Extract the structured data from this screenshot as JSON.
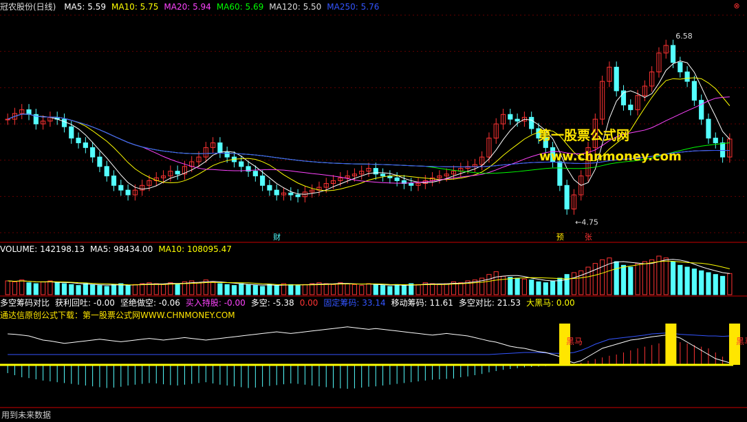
{
  "header": {
    "stock": "冠农股份(日线)",
    "ma": [
      {
        "label": "MA5: 5.59",
        "color": "#ffffff"
      },
      {
        "label": "MA10: 5.75",
        "color": "#ffff00"
      },
      {
        "label": "MA20: 5.94",
        "color": "#ff44ff"
      },
      {
        "label": "MA60: 5.69",
        "color": "#00ff00"
      },
      {
        "label": "MA120: 5.50",
        "color": "#dddddd"
      },
      {
        "label": "MA250: 5.76",
        "color": "#3355ff"
      }
    ]
  },
  "volume_header": [
    {
      "label": "VOLUME: 142198.13",
      "color": "#ffffff"
    },
    {
      "label": "MA5: 98434.00",
      "color": "#ffffff"
    },
    {
      "label": "MA10: 108095.47",
      "color": "#ffff00"
    }
  ],
  "indicator_header": [
    {
      "label": "多空筹码对比",
      "color": "#ffffff"
    },
    {
      "label": "获利回吐: -0.00",
      "color": "#ffffff"
    },
    {
      "label": "坚绝做空: -0.06",
      "color": "#ffffff"
    },
    {
      "label": "买入持股: -0.00",
      "color": "#ff44ff"
    },
    {
      "label": "多空: -5.38",
      "color": "#ffffff"
    },
    {
      "label": "0.00",
      "color": "#ff3333"
    },
    {
      "label": "固定筹码: 33.14",
      "color": "#3355ff"
    },
    {
      "label": "移动筹码: 11.61",
      "color": "#ffffff"
    },
    {
      "label": "多空对比: 21.53",
      "color": "#ffffff"
    },
    {
      "label": "大黑马: 0.00",
      "color": "#ffff00"
    }
  ],
  "indicator_note": "通达信原创公式下载：第一股票公式网WWW.CHNMONEY.COM",
  "watermark": {
    "title": "第一股票公式网",
    "url": "www.chnmoney.com"
  },
  "footer": "用到未来数据",
  "markers": {
    "cai": "财",
    "yu": "预",
    "zhang": "张",
    "heima": "黑马"
  },
  "chart_data": {
    "type": "candlestick",
    "high_label": "6.58",
    "low_label": "4.75",
    "ylim": [
      4.6,
      6.9
    ],
    "closes": [
      5.8,
      5.86,
      5.9,
      5.85,
      5.75,
      5.78,
      5.82,
      5.8,
      5.72,
      5.6,
      5.55,
      5.5,
      5.4,
      5.3,
      5.2,
      5.1,
      5.05,
      5.0,
      5.05,
      5.1,
      5.15,
      5.18,
      5.2,
      5.25,
      5.22,
      5.3,
      5.35,
      5.4,
      5.5,
      5.55,
      5.45,
      5.4,
      5.35,
      5.3,
      5.25,
      5.2,
      5.1,
      5.05,
      5.0,
      5.02,
      5.0,
      4.98,
      5.03,
      5.05,
      5.08,
      5.12,
      5.15,
      5.18,
      5.2,
      5.22,
      5.25,
      5.28,
      5.22,
      5.2,
      5.18,
      5.15,
      5.12,
      5.1,
      5.12,
      5.15,
      5.18,
      5.2,
      5.22,
      5.25,
      5.28,
      5.3,
      5.32,
      5.4,
      5.6,
      5.75,
      5.85,
      5.8,
      5.78,
      5.82,
      5.7,
      5.6,
      5.5,
      5.35,
      5.1,
      4.85,
      5.0,
      5.2,
      5.5,
      5.8,
      6.2,
      6.35,
      6.1,
      5.95,
      5.9,
      6.05,
      6.15,
      6.3,
      6.5,
      6.58,
      6.4,
      6.3,
      6.2,
      6.0,
      5.8,
      5.6,
      5.55,
      5.4,
      5.59
    ],
    "volumes": [
      15,
      14,
      16,
      13,
      12,
      14,
      15,
      13,
      12,
      11,
      10,
      12,
      11,
      10,
      9,
      11,
      12,
      10,
      11,
      12,
      13,
      12,
      11,
      13,
      12,
      14,
      15,
      13,
      16,
      14,
      12,
      11,
      10,
      12,
      11,
      10,
      9,
      11,
      10,
      12,
      11,
      10,
      11,
      12,
      13,
      12,
      11,
      13,
      12,
      11,
      10,
      12,
      11,
      10,
      9,
      11,
      10,
      12,
      11,
      13,
      12,
      11,
      12,
      14,
      13,
      15,
      16,
      18,
      22,
      25,
      20,
      19,
      18,
      17,
      16,
      14,
      13,
      15,
      18,
      22,
      24,
      26,
      30,
      34,
      38,
      40,
      36,
      32,
      30,
      34,
      36,
      38,
      42,
      40,
      36,
      32,
      30,
      28,
      26,
      24,
      22,
      20,
      23
    ],
    "indicator": {
      "fixed": [
        0.25,
        0.25,
        0.25,
        0.25,
        0.25,
        0.25,
        0.25,
        0.25,
        0.25,
        0.25,
        0.25,
        0.25,
        0.25,
        0.25,
        0.25,
        0.25,
        0.25,
        0.25,
        0.25,
        0.25,
        0.25,
        0.25,
        0.25,
        0.25,
        0.25,
        0.25,
        0.25,
        0.25,
        0.25,
        0.25,
        0.25,
        0.25,
        0.25,
        0.25,
        0.25,
        0.25,
        0.25,
        0.25,
        0.25,
        0.25,
        0.25,
        0.25,
        0.25,
        0.25,
        0.25,
        0.25,
        0.25,
        0.25,
        0.25,
        0.25,
        0.25,
        0.25,
        0.25,
        0.25,
        0.25,
        0.25,
        0.25,
        0.25,
        0.25,
        0.25,
        0.25,
        0.25,
        0.25,
        0.25,
        0.25,
        0.25,
        0.25,
        0.25,
        0.25,
        0.26,
        0.27,
        0.28,
        0.29,
        0.3,
        0.3,
        0.3,
        0.29,
        0.28,
        0.28,
        0.28,
        0.3,
        0.35,
        0.42,
        0.5,
        0.56,
        0.62,
        0.64,
        0.66,
        0.68,
        0.7,
        0.72,
        0.75,
        0.76,
        0.77,
        0.76,
        0.74,
        0.73,
        0.72,
        0.71,
        0.7,
        0.7,
        0.69,
        0.7
      ],
      "moving": [
        0.75,
        0.74,
        0.72,
        0.7,
        0.65,
        0.6,
        0.58,
        0.55,
        0.52,
        0.54,
        0.56,
        0.58,
        0.6,
        0.62,
        0.6,
        0.58,
        0.56,
        0.58,
        0.6,
        0.62,
        0.64,
        0.62,
        0.6,
        0.62,
        0.64,
        0.66,
        0.64,
        0.62,
        0.6,
        0.62,
        0.64,
        0.66,
        0.68,
        0.7,
        0.72,
        0.74,
        0.76,
        0.78,
        0.8,
        0.78,
        0.76,
        0.78,
        0.8,
        0.82,
        0.84,
        0.86,
        0.88,
        0.9,
        0.92,
        0.9,
        0.88,
        0.86,
        0.88,
        0.86,
        0.84,
        0.82,
        0.8,
        0.78,
        0.76,
        0.74,
        0.72,
        0.74,
        0.76,
        0.74,
        0.72,
        0.7,
        0.66,
        0.62,
        0.58,
        0.55,
        0.5,
        0.45,
        0.42,
        0.4,
        0.36,
        0.32,
        0.3,
        0.25,
        0.2,
        0.1,
        0.05,
        0.1,
        0.2,
        0.3,
        0.4,
        0.45,
        0.5,
        0.55,
        0.6,
        0.62,
        0.65,
        0.68,
        0.7,
        0.72,
        0.7,
        0.65,
        0.55,
        0.45,
        0.35,
        0.25,
        0.15,
        0.1,
        0.05
      ],
      "histogram": [
        -0.2,
        -0.25,
        -0.3,
        -0.32,
        -0.35,
        -0.38,
        -0.4,
        -0.42,
        -0.44,
        -0.46,
        -0.48,
        -0.5,
        -0.52,
        -0.54,
        -0.56,
        -0.55,
        -0.53,
        -0.5,
        -0.48,
        -0.46,
        -0.44,
        -0.45,
        -0.47,
        -0.49,
        -0.5,
        -0.48,
        -0.46,
        -0.44,
        -0.42,
        -0.45,
        -0.48,
        -0.5,
        -0.52,
        -0.54,
        -0.56,
        -0.55,
        -0.53,
        -0.51,
        -0.49,
        -0.47,
        -0.45,
        -0.46,
        -0.48,
        -0.5,
        -0.52,
        -0.54,
        -0.56,
        -0.57,
        -0.58,
        -0.57,
        -0.55,
        -0.53,
        -0.52,
        -0.5,
        -0.48,
        -0.46,
        -0.44,
        -0.42,
        -0.4,
        -0.38,
        -0.36,
        -0.35,
        -0.34,
        -0.33,
        -0.3,
        -0.28,
        -0.25,
        -0.22,
        -0.18,
        -0.15,
        -0.12,
        -0.1,
        -0.08,
        -0.06,
        -0.05,
        -0.04,
        -0.03,
        -0.02,
        -0.02,
        -0.01,
        0.02,
        0.05,
        0.1,
        0.14,
        0.18,
        0.22,
        0.25,
        0.3,
        0.35,
        0.4,
        0.44,
        0.48,
        0.52,
        0.55,
        0.58,
        0.55,
        0.52,
        0.48,
        0.44,
        0.4,
        0.3,
        0.2,
        0.1
      ],
      "heima_bars": [
        79,
        94,
        103
      ]
    }
  }
}
